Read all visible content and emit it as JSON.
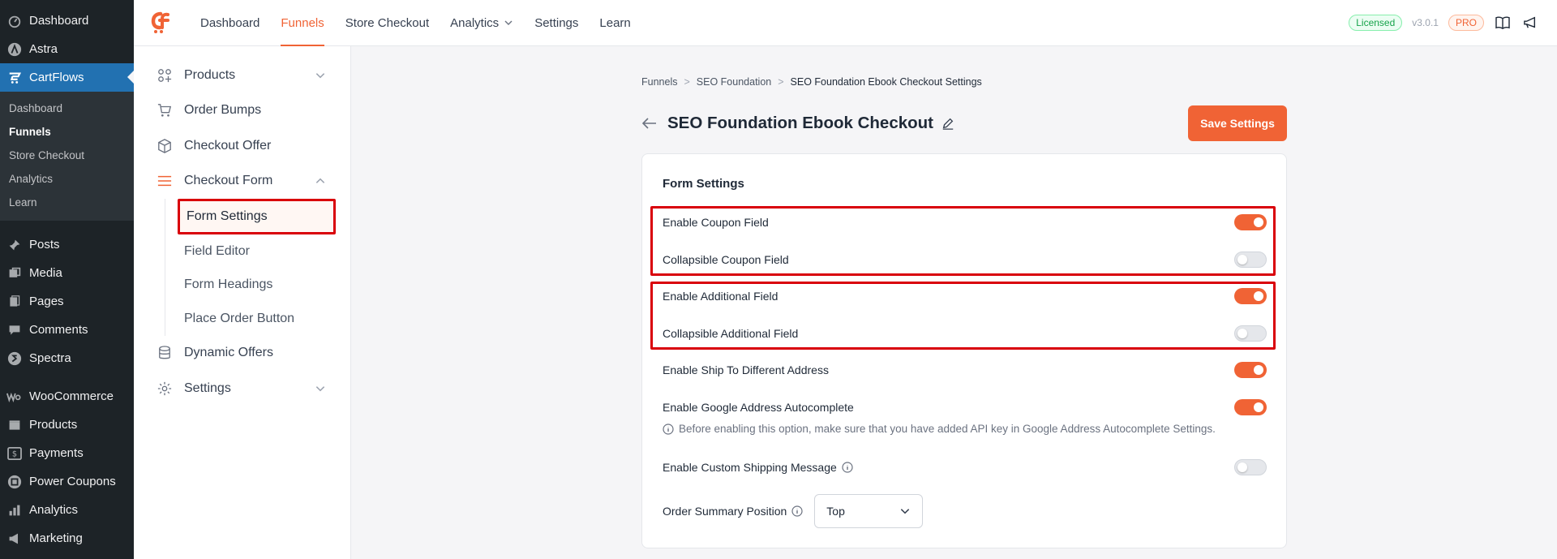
{
  "wp_sidebar": {
    "top_items": [
      {
        "label": "Dashboard",
        "icon": "dashboard-icon"
      },
      {
        "label": "Astra",
        "icon": "astra-icon"
      }
    ],
    "active_item": {
      "label": "CartFlows",
      "icon": "cartflows-icon"
    },
    "submenu": [
      "Dashboard",
      "Funnels",
      "Store Checkout",
      "Analytics",
      "Learn"
    ],
    "submenu_current": "Funnels",
    "group1": [
      {
        "label": "Posts",
        "icon": "pin-icon"
      },
      {
        "label": "Media",
        "icon": "media-icon"
      },
      {
        "label": "Pages",
        "icon": "pages-icon"
      },
      {
        "label": "Comments",
        "icon": "comments-icon"
      },
      {
        "label": "Spectra",
        "icon": "spectra-icon"
      }
    ],
    "group2": [
      {
        "label": "WooCommerce",
        "icon": "woocommerce-icon"
      },
      {
        "label": "Products",
        "icon": "products-icon"
      },
      {
        "label": "Payments",
        "icon": "payments-icon"
      },
      {
        "label": "Power Coupons",
        "icon": "power-coupons-icon"
      },
      {
        "label": "Analytics",
        "icon": "analytics-icon"
      },
      {
        "label": "Marketing",
        "icon": "marketing-icon"
      }
    ]
  },
  "topbar": {
    "nav": [
      "Dashboard",
      "Funnels",
      "Store Checkout",
      "Analytics",
      "Settings",
      "Learn"
    ],
    "active": "Funnels",
    "licensed": "Licensed",
    "version": "v3.0.1",
    "pro": "PRO",
    "accent": "#f06335"
  },
  "inner_sidebar": {
    "items_top": [
      "Products",
      "Order Bumps",
      "Checkout Offer"
    ],
    "expanded_item": "Checkout Form",
    "sub_items": [
      "Form Settings",
      "Field Editor",
      "Form Headings",
      "Place Order Button"
    ],
    "sub_active": "Form Settings",
    "items_bottom": [
      "Dynamic Offers",
      "Settings"
    ]
  },
  "breadcrumb": [
    "Funnels",
    "SEO Foundation",
    "SEO Foundation Ebook Checkout Settings"
  ],
  "breadcrumb_sep": ">",
  "page_title": "SEO Foundation Ebook Checkout",
  "save_button": "Save Settings",
  "form": {
    "heading": "Form Settings",
    "rows": [
      {
        "label": "Enable Coupon Field",
        "on": true
      },
      {
        "label": "Collapsible Coupon Field",
        "on": false
      },
      {
        "label": "Enable Additional Field",
        "on": true
      },
      {
        "label": "Collapsible Additional Field",
        "on": false
      },
      {
        "label": "Enable Ship To Different Address",
        "on": true
      },
      {
        "label": "Enable Google Address Autocomplete",
        "on": true
      },
      {
        "label": "Enable Custom Shipping Message",
        "on": false
      }
    ],
    "hint": "Before enabling this option, make sure that you have added API key in Google Address Autocomplete Settings.",
    "order_summary_label": "Order Summary Position",
    "order_summary_value": "Top"
  }
}
